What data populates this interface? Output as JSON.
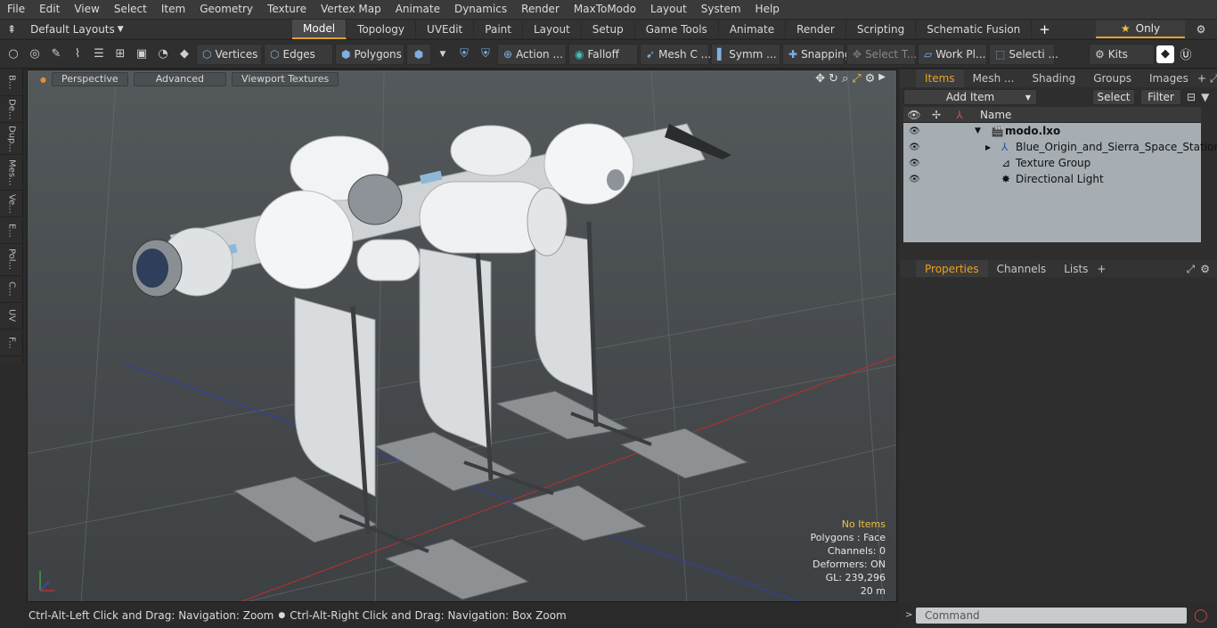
{
  "menu": [
    "File",
    "Edit",
    "View",
    "Select",
    "Item",
    "Geometry",
    "Texture",
    "Vertex Map",
    "Animate",
    "Dynamics",
    "Render",
    "MaxToModo",
    "Layout",
    "System",
    "Help"
  ],
  "tabs": {
    "layout_label": "Default Layouts",
    "items": [
      "Model",
      "Topology",
      "UVEdit",
      "Paint",
      "Layout",
      "Setup",
      "Game Tools",
      "Animate",
      "Render",
      "Scripting",
      "Schematic Fusion"
    ],
    "active": "Model",
    "only_label": "Only"
  },
  "toolbar": {
    "vertices": "Vertices",
    "edges": "Edges",
    "polygons": "Polygons",
    "action": "Action ...",
    "falloff": "Falloff",
    "mesh": "Mesh C ...",
    "symm": "Symm ...",
    "snapping": "Snapping",
    "select_t": "Select T...",
    "work_pl": "Work Pl...",
    "selecti": "Selecti ...",
    "kits": "Kits"
  },
  "left_tabs": [
    "B...",
    "De...",
    "Dup...",
    "Mes...",
    "Ve...",
    "E...",
    "Pol...",
    "C...",
    "UV",
    "F..."
  ],
  "viewport": {
    "perspective": "Perspective",
    "advanced": "Advanced",
    "textures": "Viewport Textures",
    "stats": {
      "items": "No Items",
      "polygons": "Polygons : Face",
      "channels": "Channels: 0",
      "deformers": "Deformers: ON",
      "gl": "GL: 239,296",
      "distance": "20 m"
    }
  },
  "status": {
    "left": "Ctrl-Alt-Left Click and Drag: Navigation: Zoom",
    "right": "Ctrl-Alt-Right Click and Drag: Navigation: Box Zoom"
  },
  "right": {
    "top_tabs": [
      "Items",
      "Mesh ...",
      "Shading",
      "Groups",
      "Images"
    ],
    "top_active": "Items",
    "add_item": "Add Item",
    "select": "Select",
    "filter": "Filter",
    "name_col": "Name",
    "tree": [
      {
        "label": "modo.lxo",
        "bold": true
      },
      {
        "label": "Blue_Origin_and_Sierra_Space_Station",
        "bold": false
      },
      {
        "label": "Texture Group",
        "bold": false
      },
      {
        "label": "Directional Light",
        "bold": false
      }
    ],
    "bottom_tabs": [
      "Properties",
      "Channels",
      "Lists"
    ],
    "bottom_active": "Properties",
    "command_placeholder": "Command"
  },
  "colors": {
    "accent": "#e0a030",
    "active_tab_text": "#f0a020",
    "stats_highlight": "#f0c040",
    "tree_bg": "#a6adb3"
  }
}
